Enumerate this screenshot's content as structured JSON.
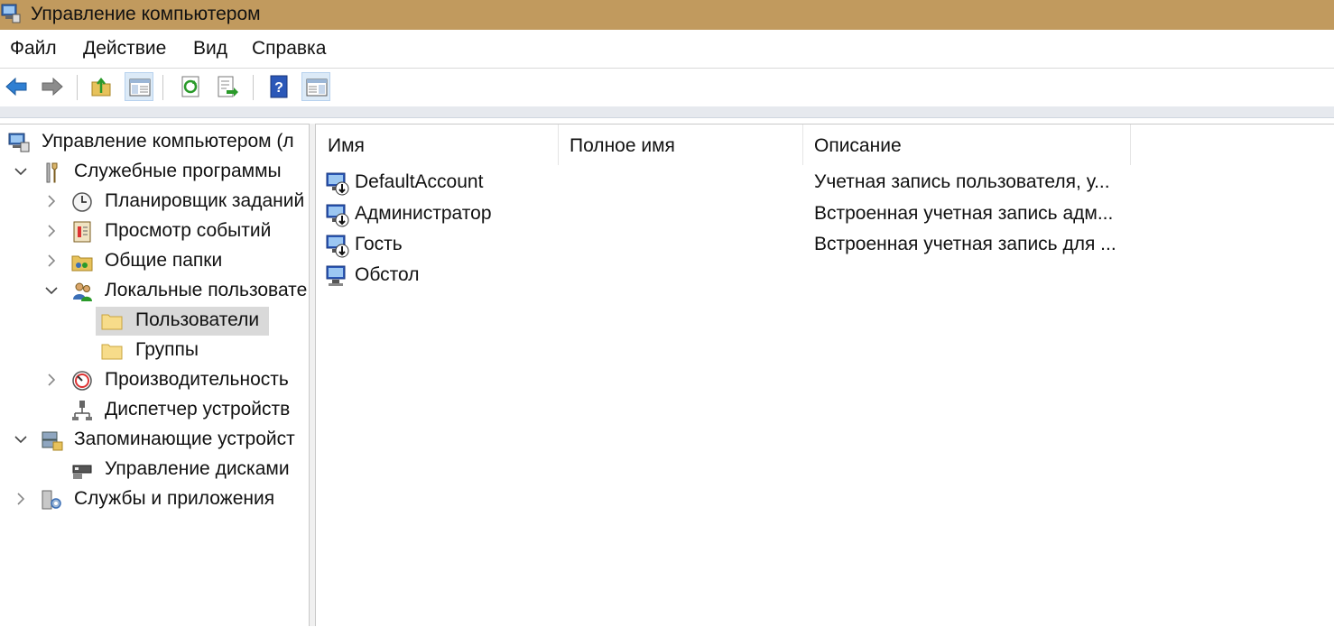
{
  "window": {
    "title": "Управление компьютером"
  },
  "menu": [
    "Файл",
    "Действие",
    "Вид",
    "Справка"
  ],
  "toolbar": {
    "buttons": [
      "back-icon",
      "forward-icon",
      "up-folder-icon",
      "show-hide-tree-icon",
      "refresh-icon",
      "export-list-icon",
      "help-icon",
      "show-hide-action-pane-icon"
    ]
  },
  "tree": {
    "items": [
      {
        "label": "Управление компьютером (л",
        "icon": "computer-management-icon"
      },
      {
        "label": "Служебные программы",
        "icon": "tools-icon"
      },
      {
        "label": "Планировщик заданий",
        "icon": "clock-icon"
      },
      {
        "label": "Просмотр событий",
        "icon": "event-viewer-icon"
      },
      {
        "label": "Общие папки",
        "icon": "shared-folders-icon"
      },
      {
        "label": "Локальные пользовате",
        "icon": "users-icon"
      },
      {
        "label": "Пользователи",
        "icon": "folder-icon"
      },
      {
        "label": "Группы",
        "icon": "folder-icon"
      },
      {
        "label": "Производительность",
        "icon": "performance-icon"
      },
      {
        "label": "Диспетчер устройств",
        "icon": "device-manager-icon"
      },
      {
        "label": "Запоминающие устройст",
        "icon": "storage-icon"
      },
      {
        "label": "Управление дисками",
        "icon": "disk-management-icon"
      },
      {
        "label": "Службы и приложения",
        "icon": "services-icon"
      }
    ]
  },
  "list": {
    "columns": [
      "Имя",
      "Полное имя",
      "Описание"
    ],
    "rows": [
      {
        "name": "DefaultAccount",
        "full_name": "",
        "description": "Учетная запись пользователя, у..."
      },
      {
        "name": "Администратор",
        "full_name": "",
        "description": "Встроенная учетная запись адм..."
      },
      {
        "name": "Гость",
        "full_name": "",
        "description": "Встроенная учетная запись для ..."
      },
      {
        "name": "Обстол",
        "full_name": "",
        "description": ""
      }
    ]
  },
  "colors": {
    "titlebar": "#c19a5e",
    "selection": "#d9d9d9",
    "accent": "#2f7fd2"
  }
}
